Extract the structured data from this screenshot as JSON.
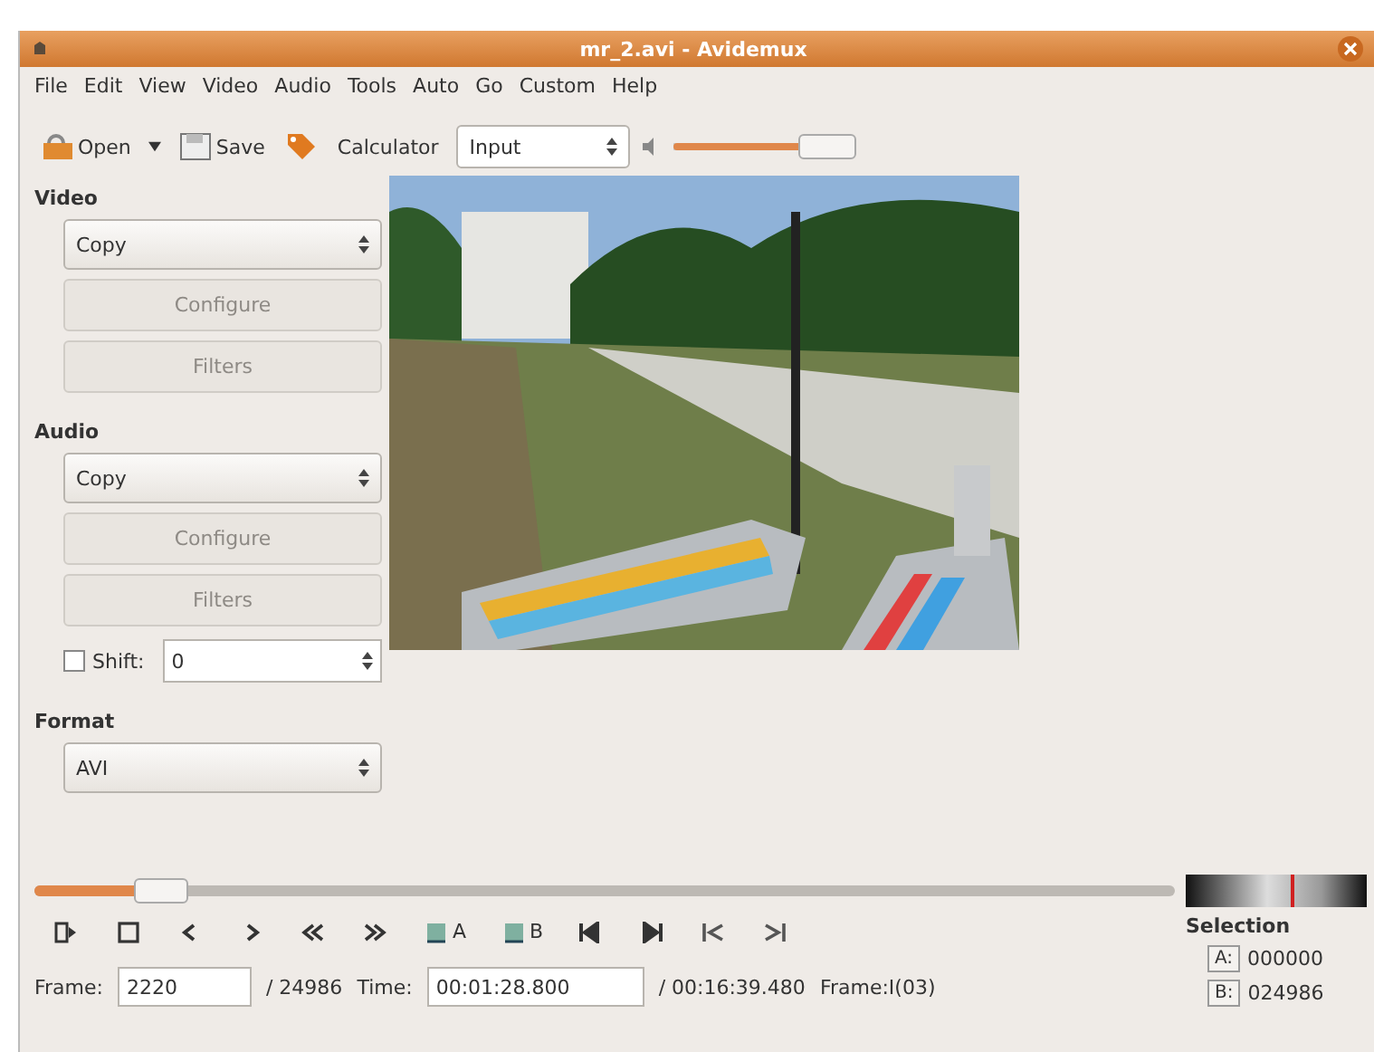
{
  "window": {
    "title": "mr_2.avi - Avidemux"
  },
  "menu": [
    "File",
    "Edit",
    "View",
    "Video",
    "Audio",
    "Tools",
    "Auto",
    "Go",
    "Custom",
    "Help"
  ],
  "toolbar": {
    "open": "Open",
    "save": "Save",
    "calculator": "Calculator",
    "input": "Input",
    "volume": {
      "level": 0.85
    }
  },
  "video": {
    "heading": "Video",
    "codec": "Copy",
    "configure": {
      "label": "Configure",
      "disabled": true
    },
    "filters": {
      "label": "Filters",
      "disabled": true
    }
  },
  "audio": {
    "heading": "Audio",
    "codec": "Copy",
    "configure": {
      "label": "Configure",
      "disabled": true
    },
    "filters": {
      "label": "Filters",
      "disabled": true
    },
    "shift": {
      "label": "Shift:",
      "checked": false,
      "value": "0"
    }
  },
  "format": {
    "heading": "Format",
    "value": "AVI"
  },
  "timeline": {
    "level": 0.11
  },
  "controls": [
    {
      "kind": "play"
    },
    {
      "kind": "stop"
    },
    {
      "kind": "prev"
    },
    {
      "kind": "next"
    },
    {
      "kind": "rewind"
    },
    {
      "kind": "forward"
    },
    {
      "kind": "mark-a",
      "label": "A"
    },
    {
      "kind": "mark-b",
      "label": "B"
    },
    {
      "kind": "first"
    },
    {
      "kind": "last"
    },
    {
      "kind": "prev-key"
    },
    {
      "kind": "next-key"
    }
  ],
  "status": {
    "frame_label": "Frame:",
    "frame": "2220",
    "total_frames": "/ 24986",
    "time_label": "Time:",
    "time": "00:01:28.800",
    "duration": "/ 00:16:39.480",
    "frame_type": "Frame:I(03)"
  },
  "selection": {
    "heading": "Selection",
    "a_label": "A:",
    "a_value": "000000",
    "b_label": "B:",
    "b_value": "024986"
  }
}
